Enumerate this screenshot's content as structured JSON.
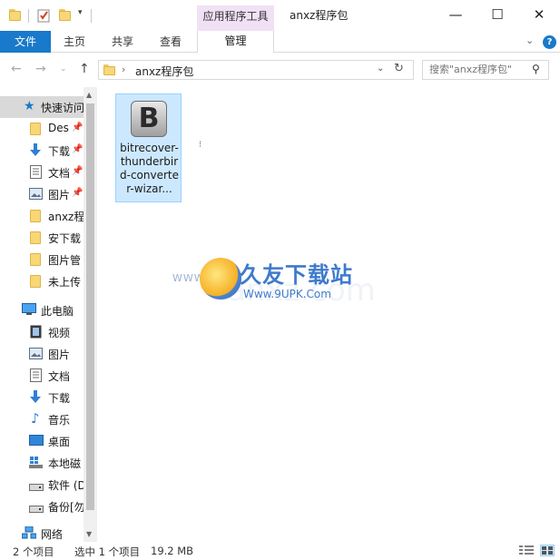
{
  "window": {
    "title": "anxz程序包",
    "context_tab_title": "应用程序工具",
    "buttons": {
      "minimize": "—",
      "maximize": "☐",
      "close": "✕"
    }
  },
  "ribbon": {
    "tabs": [
      "文件",
      "主页",
      "共享",
      "查看"
    ],
    "context_tab": "管理",
    "file_tab_color": "#1979ca",
    "context_color": "#f1e1f5"
  },
  "address": {
    "path": "anxz程序包",
    "search_placeholder": "搜索\"anxz程序包\""
  },
  "nav": {
    "quick_access": "快速访问",
    "items": [
      {
        "label": "Des",
        "icon": "folder-icon",
        "pinned": true
      },
      {
        "label": "下载",
        "icon": "download-arrow-icon",
        "pinned": true
      },
      {
        "label": "文档",
        "icon": "document-icon",
        "pinned": true
      },
      {
        "label": "图片",
        "icon": "picture-icon",
        "pinned": true
      },
      {
        "label": "anxz程",
        "icon": "folder-icon",
        "pinned": false
      },
      {
        "label": "安下载",
        "icon": "folder-icon",
        "pinned": false
      },
      {
        "label": "图片管",
        "icon": "folder-icon",
        "pinned": false
      },
      {
        "label": "未上传",
        "icon": "folder-icon",
        "pinned": false
      }
    ],
    "this_pc": "此电脑",
    "pc_items": [
      {
        "label": "视频",
        "icon": "video-icon"
      },
      {
        "label": "图片",
        "icon": "picture-icon"
      },
      {
        "label": "文档",
        "icon": "document-icon"
      },
      {
        "label": "下载",
        "icon": "download-arrow-icon"
      },
      {
        "label": "音乐",
        "icon": "music-note-icon"
      },
      {
        "label": "桌面",
        "icon": "desktop-icon"
      },
      {
        "label": "本地磁",
        "icon": "windows-drive-icon"
      },
      {
        "label": "软件 (D",
        "icon": "drive-icon"
      },
      {
        "label": "备份[勿",
        "icon": "drive-icon"
      }
    ],
    "network": "网络"
  },
  "content": {
    "files": [
      {
        "icon_letter": "B",
        "name": "bitrecover-thunderbird-converter-wizar..."
      }
    ],
    "watermark": {
      "title": "久友下载站",
      "url": "Www.9UPK.Com",
      "left_text": "WWW.9U",
      "bg_text": "anxz.com"
    }
  },
  "status": {
    "item_count": "2 个项目",
    "selection": "选中 1 个项目",
    "size": "19.2 MB"
  }
}
